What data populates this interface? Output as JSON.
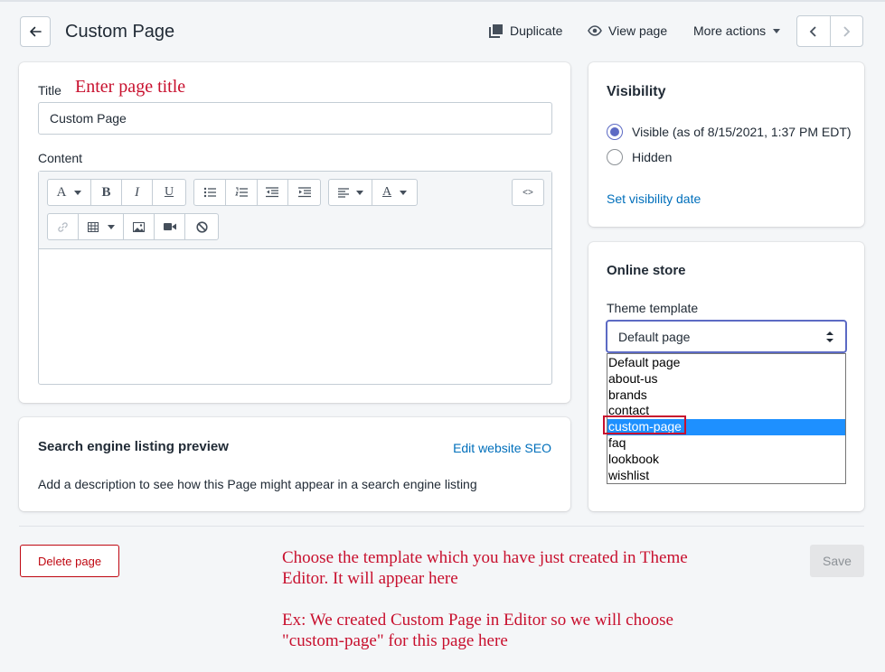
{
  "header": {
    "back_icon": "arrow-left-icon",
    "title": "Custom Page",
    "duplicate_label": "Duplicate",
    "view_page_label": "View page",
    "more_actions_label": "More actions"
  },
  "title_section": {
    "label": "Title",
    "annotation": "Enter page title",
    "value": "Custom Page"
  },
  "content_section": {
    "label": "Content",
    "toolbar": {
      "font_icon": "A",
      "bold": "B",
      "italic": "I",
      "underline": "U",
      "text_color_icon": "A",
      "html_toggle": "<>"
    }
  },
  "seo": {
    "title": "Search engine listing preview",
    "edit_link": "Edit website SEO",
    "description": "Add a description to see how this Page might appear in a search engine listing"
  },
  "visibility": {
    "title": "Visibility",
    "visible_label": "Visible (as of 8/15/2021, 1:37 PM EDT)",
    "hidden_label": "Hidden",
    "set_date_link": "Set visibility date",
    "selected": "visible"
  },
  "online_store": {
    "title": "Online store",
    "template_label": "Theme template",
    "selected_value": "Default page",
    "options": [
      "Default page",
      "about-us",
      "brands",
      "contact",
      "custom-page",
      "faq",
      "lookbook",
      "wishlist"
    ],
    "highlighted_option": "custom-page"
  },
  "footer": {
    "delete_label": "Delete page",
    "save_label": "Save"
  },
  "annotations": {
    "template_note_1": "Choose the template which you have just created in Theme Editor. It will appear here",
    "template_note_2": "Ex: We created Custom Page in Editor so we will choose \"custom-page\" for this page here"
  },
  "colors": {
    "accent": "#006fbb",
    "radio_selected": "#5c6ac4",
    "annotation_red": "#c8102e",
    "delete_red": "#bf0711",
    "option_highlight": "#1e90ff"
  }
}
